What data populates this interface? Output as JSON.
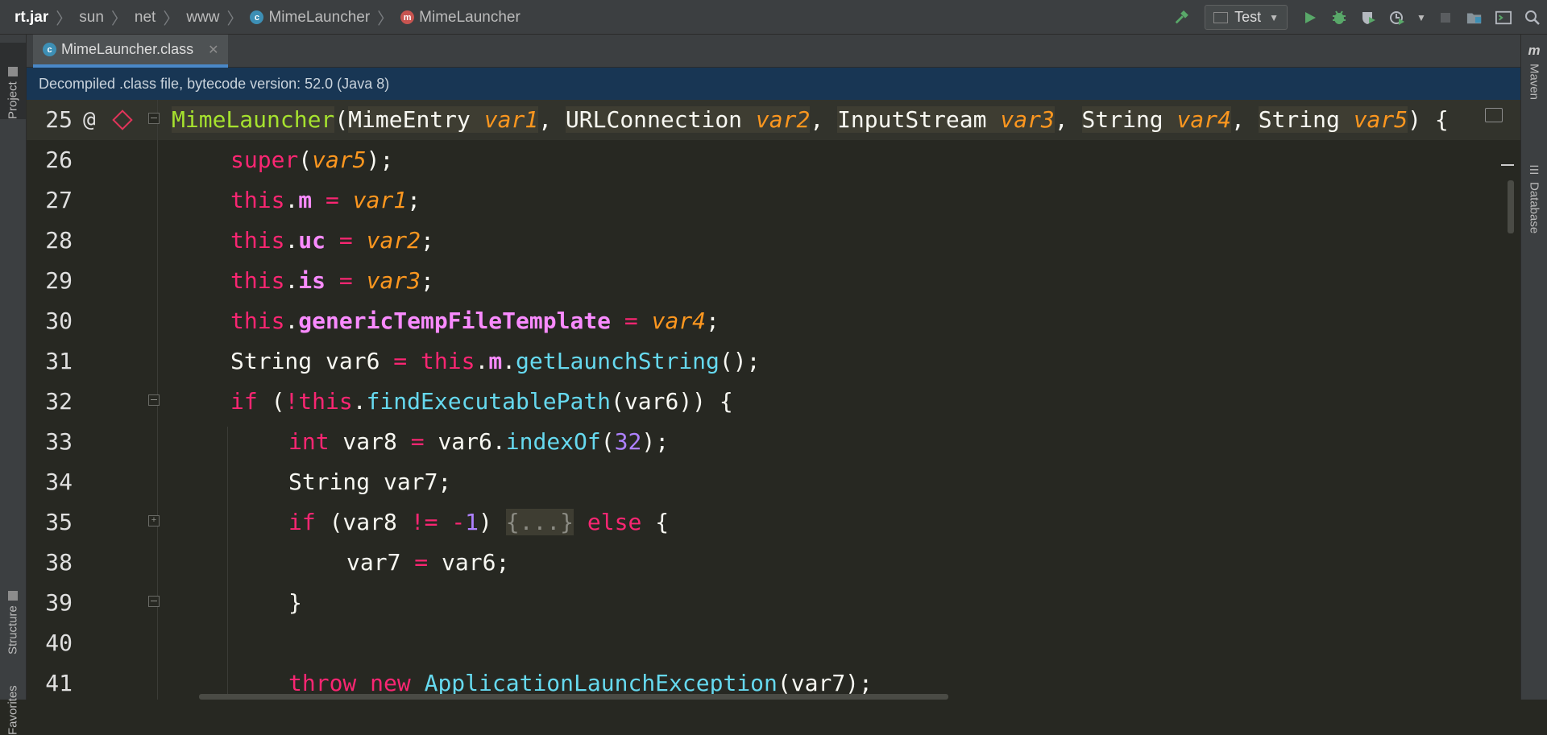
{
  "breadcrumb": {
    "items": [
      {
        "label": "rt.jar",
        "icon": ""
      },
      {
        "label": "sun",
        "icon": ""
      },
      {
        "label": "net",
        "icon": ""
      },
      {
        "label": "www",
        "icon": ""
      },
      {
        "label": "MimeLauncher",
        "icon": "class-icon"
      },
      {
        "label": "MimeLauncher",
        "icon": "method-icon"
      }
    ]
  },
  "toolbar": {
    "run_config": "Test"
  },
  "tools": {
    "project": "Project",
    "structure": "Structure",
    "favorites": "Favorites",
    "maven": "Maven",
    "database": "Database"
  },
  "tab": {
    "label": "MimeLauncher.class"
  },
  "banner": {
    "text": "Decompiled .class file, bytecode version: 52.0 (Java 8)"
  },
  "code": {
    "lines": [
      {
        "num": "25"
      },
      {
        "num": "26"
      },
      {
        "num": "27"
      },
      {
        "num": "28"
      },
      {
        "num": "29"
      },
      {
        "num": "30"
      },
      {
        "num": "31"
      },
      {
        "num": "32"
      },
      {
        "num": "33"
      },
      {
        "num": "34"
      },
      {
        "num": "35"
      },
      {
        "num": "38"
      },
      {
        "num": "39"
      },
      {
        "num": "40"
      },
      {
        "num": "41"
      }
    ]
  },
  "colors": {
    "keyword": "#f92672",
    "parameter": "#fd971f",
    "class_name": "#a6e22e",
    "field": "#f98bff",
    "method_call": "#66d9ef",
    "number": "#ae81ff",
    "banner_bg": "#183654"
  }
}
